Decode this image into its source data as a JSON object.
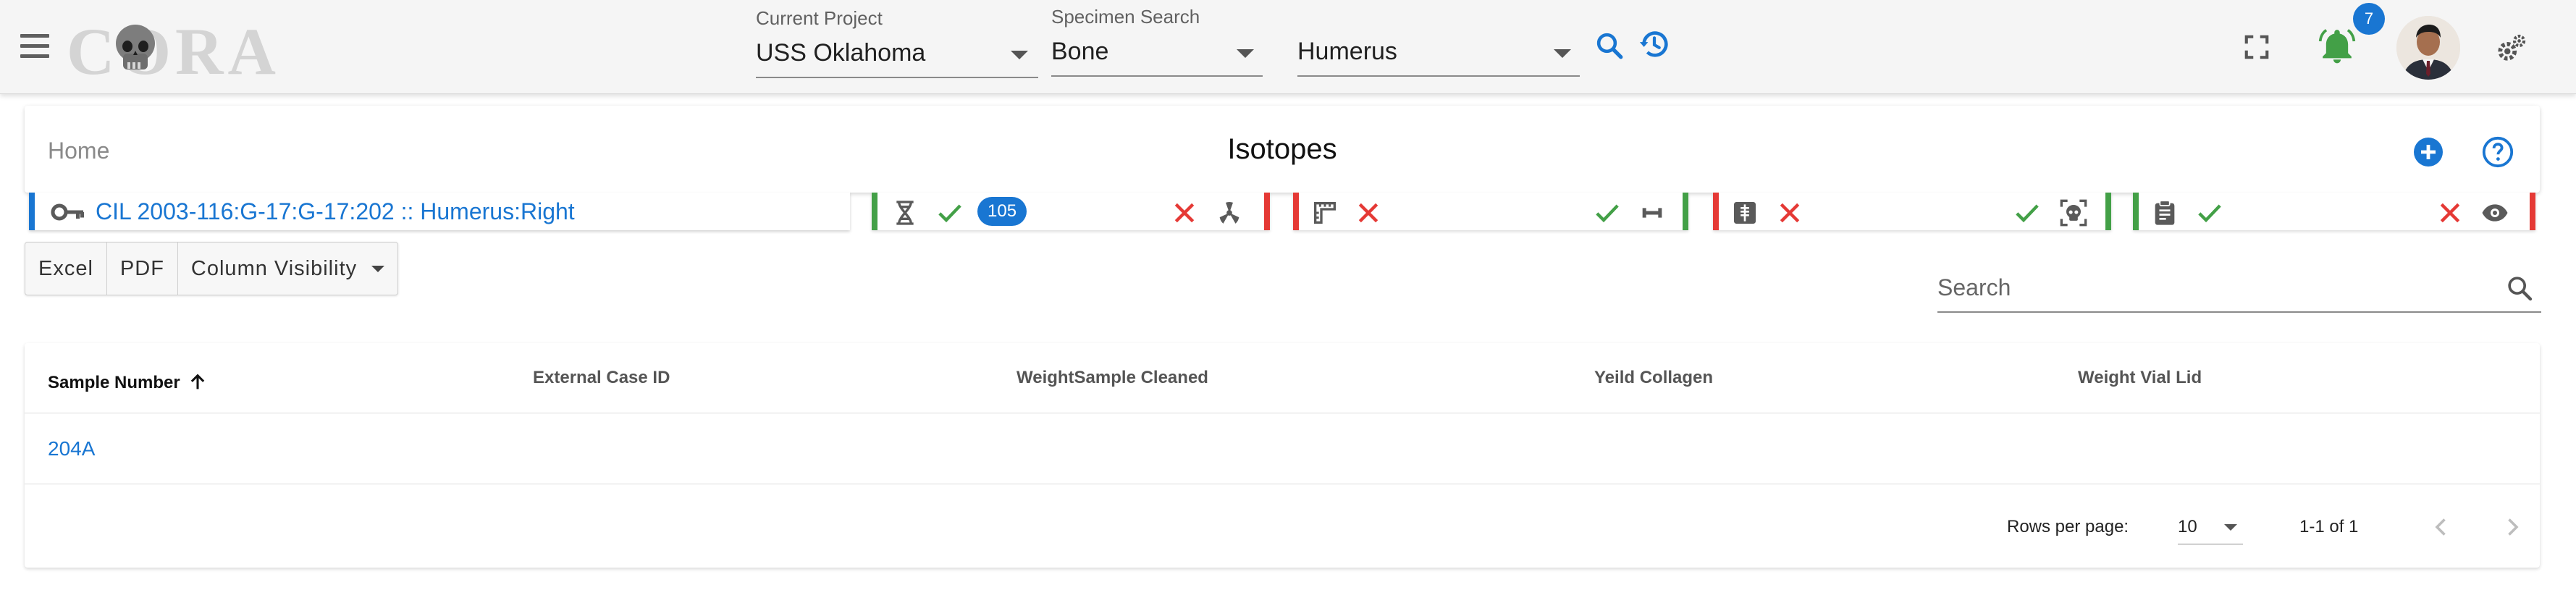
{
  "app": {
    "logo_text": "CORA",
    "current_project": {
      "label": "Current Project",
      "value": "USS Oklahoma"
    },
    "specimen_search": {
      "label": "Specimen Search",
      "value": "Bone"
    },
    "element_select": {
      "value": "Humerus"
    },
    "notifications_count": "7"
  },
  "page": {
    "breadcrumb": "Home",
    "title": "Isotopes"
  },
  "status_strip": {
    "specimen_key": "CIL 2003-116:G-17:G-17:202 :: Humerus:Right",
    "dna_count": "105",
    "colors": {
      "ok": "#43a047",
      "bad": "#e53935",
      "blue": "#1976d2"
    }
  },
  "toolbar": {
    "excel": "Excel",
    "pdf": "PDF",
    "column_visibility": "Column Visibility",
    "search_placeholder": "Search"
  },
  "table": {
    "columns": [
      "Sample Number",
      "External Case ID",
      "WeightSample Cleaned",
      "Yeild Collagen",
      "Weight Vial Lid"
    ],
    "rows": [
      {
        "sample_number": "204A"
      }
    ],
    "pagination": {
      "rows_per_page_label": "Rows per page:",
      "rows_per_page": "10",
      "range": "1-1 of 1"
    }
  }
}
